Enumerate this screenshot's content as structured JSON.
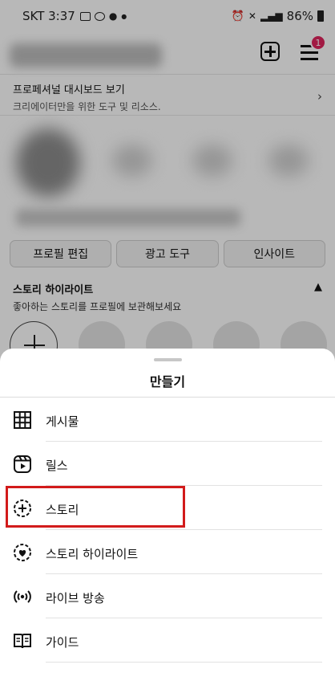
{
  "status_bar": {
    "carrier_time": "SKT 3:37",
    "battery": "86%"
  },
  "header": {
    "notification_count": "1"
  },
  "dashboard": {
    "title": "프로페셔널 대시보드 보기",
    "subtitle": "크리에이터만을 위한 도구 및 리소스."
  },
  "profile_buttons": {
    "edit": "프로필 편집",
    "ads": "광고 도구",
    "insights": "인사이트"
  },
  "highlights": {
    "title": "스토리 하이라이트",
    "subtitle": "좋아하는 스토리를 프로필에 보관해보세요"
  },
  "sheet": {
    "title": "만들기",
    "items": [
      {
        "label": "게시물",
        "icon": "grid-icon"
      },
      {
        "label": "릴스",
        "icon": "reels-icon"
      },
      {
        "label": "스토리",
        "icon": "story-add-icon"
      },
      {
        "label": "스토리 하이라이트",
        "icon": "highlight-heart-icon"
      },
      {
        "label": "라이브 방송",
        "icon": "live-broadcast-icon"
      },
      {
        "label": "가이드",
        "icon": "guide-book-icon"
      }
    ]
  },
  "highlight_color": "#d21b1b"
}
